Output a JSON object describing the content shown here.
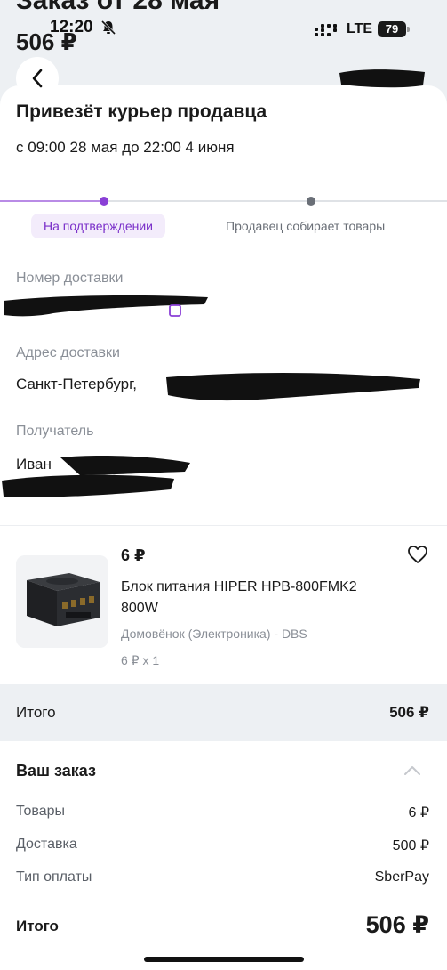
{
  "status_bar": {
    "time": "12:20",
    "network": "LTE",
    "battery": "79"
  },
  "header": {
    "ghost_title": "Заказ от 28 мая",
    "ghost_price": "506 ₽"
  },
  "delivery": {
    "title": "Привезёт курьер продавца",
    "time_window": "с 09:00 28 мая до 22:00 4 июня",
    "current_status": "На подтверждении",
    "next_status": "Продавец собирает товары",
    "accent_color": "#8a3fd6"
  },
  "fields": {
    "delivery_number_label": "Номер доставки",
    "address_label": "Адрес доставки",
    "address_value": "Санкт-Петербург,",
    "recipient_label": "Получатель",
    "recipient_value": "Иван"
  },
  "product": {
    "price": "6 ₽",
    "name": "Блок питания HIPER HPB-800FMK2 800W",
    "seller": "Домовёнок (Электроника) - DBS",
    "qty": "6 ₽ x 1"
  },
  "total_band": {
    "label": "Итого",
    "value": "506 ₽"
  },
  "order_summary": {
    "title": "Ваш заказ",
    "rows": [
      {
        "label": "Товары",
        "value": "6 ₽"
      },
      {
        "label": "Доставка",
        "value": "500 ₽"
      },
      {
        "label": "Тип оплаты",
        "value": "SberPay"
      }
    ],
    "total_label": "Итого",
    "total_value": "506 ₽"
  }
}
